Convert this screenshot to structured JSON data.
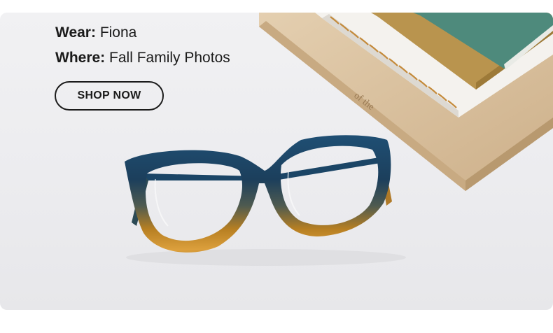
{
  "hero": {
    "wear_key": "Wear:",
    "wear_value": "Fiona",
    "where_key": "Where:",
    "where_value": "Fall Family Photos",
    "cta_label": "SHOP NOW"
  },
  "book_spine_text": "of the",
  "colors": {
    "text": "#1b1b1b",
    "background": "#ececef",
    "frame_blue": "#1d4b6e",
    "frame_amber": "#c8861b",
    "book_tan": "#d8c0a0",
    "notebook_teal": "#4e8a7c"
  }
}
